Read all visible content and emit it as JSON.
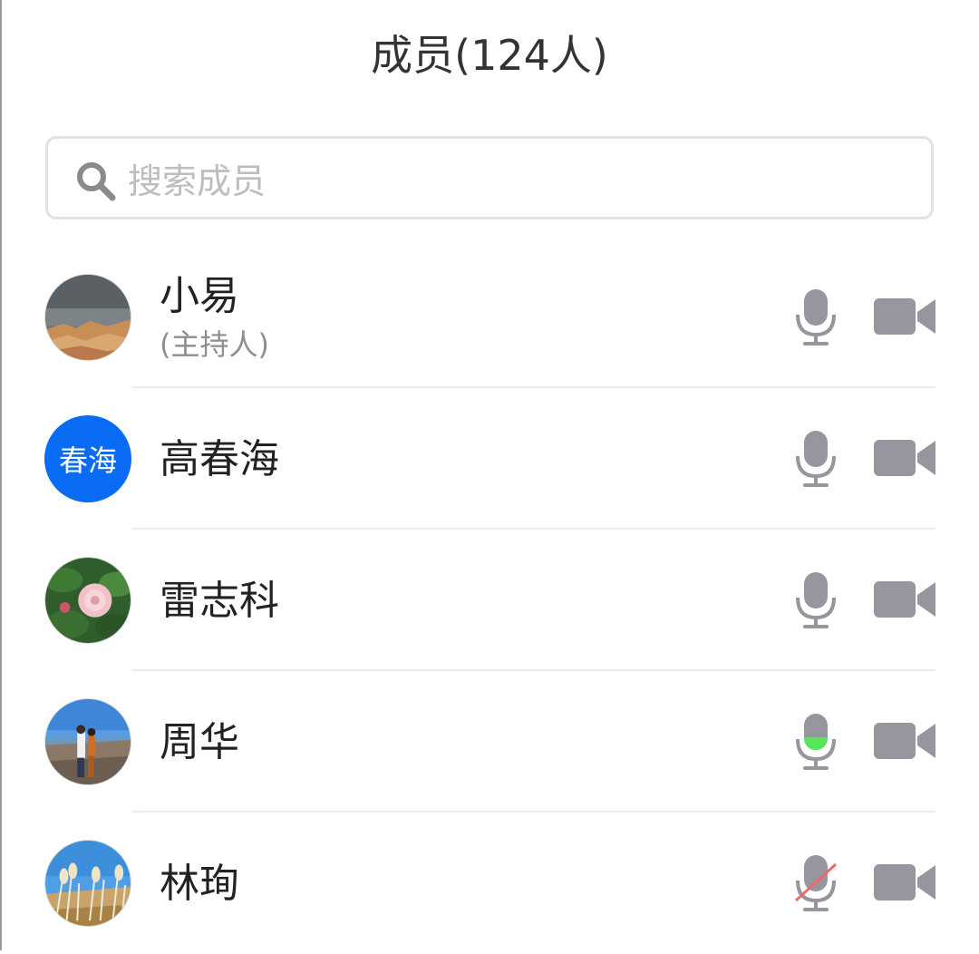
{
  "header": {
    "title": "成员(124人)"
  },
  "search": {
    "placeholder": "搜索成员",
    "icon": "search-icon"
  },
  "colors": {
    "accent_avatar": "#0a6cf5",
    "icon_gray": "#96969f",
    "speaking_green": "#55e65a",
    "muted_red": "#ee6a66"
  },
  "members": [
    {
      "name": "小易",
      "role": "(主持人)",
      "avatar": "photo-landscape",
      "mic_state": "on",
      "camera_state": "off"
    },
    {
      "name": "高春海",
      "role": "",
      "avatar_initials": "春海",
      "mic_state": "on",
      "camera_state": "off"
    },
    {
      "name": "雷志科",
      "role": "",
      "avatar": "photo-flower",
      "mic_state": "on",
      "camera_state": "off"
    },
    {
      "name": "周华",
      "role": "",
      "avatar": "photo-beach",
      "mic_state": "speaking",
      "camera_state": "off"
    },
    {
      "name": "林珣",
      "role": "",
      "avatar": "photo-reeds",
      "mic_state": "muted",
      "camera_state": "off"
    }
  ]
}
